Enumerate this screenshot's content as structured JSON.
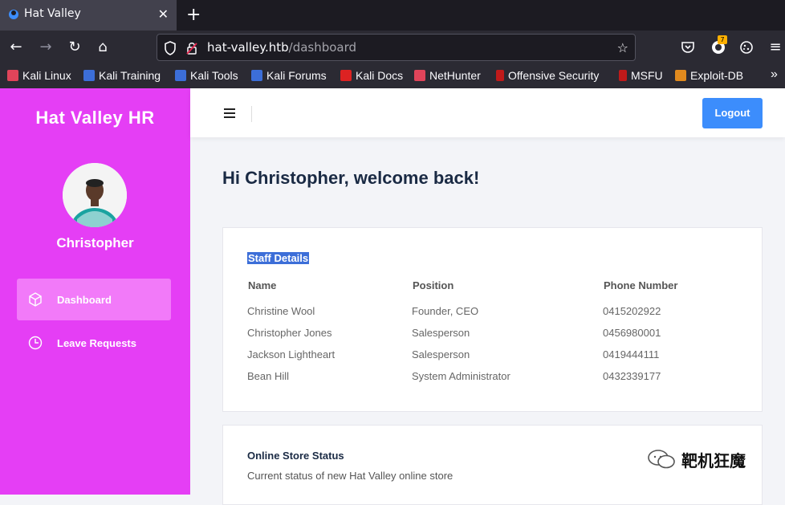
{
  "browser": {
    "tab_title": "Hat Valley",
    "url_host": "hat-valley.htb",
    "url_path": "/dashboard",
    "extension_badge": "7",
    "bookmarks": [
      "Kali Linux",
      "Kali Training",
      "Kali Tools",
      "Kali Forums",
      "Kali Docs",
      "NetHunter",
      "Offensive Security",
      "MSFU",
      "Exploit-DB"
    ]
  },
  "sidebar": {
    "brand": "Hat Valley HR",
    "user_name": "Christopher",
    "items": [
      {
        "label": "Dashboard",
        "icon": "cube-icon"
      },
      {
        "label": "Leave Requests",
        "icon": "clock-icon"
      }
    ]
  },
  "topbar": {
    "logout_label": "Logout"
  },
  "main": {
    "welcome": "Hi Christopher, welcome back!",
    "staff": {
      "title": "Staff Details",
      "columns": [
        "Name",
        "Position",
        "Phone Number"
      ],
      "rows": [
        [
          "Christine Wool",
          "Founder, CEO",
          "0415202922"
        ],
        [
          "Christopher Jones",
          "Salesperson",
          "0456980001"
        ],
        [
          "Jackson Lightheart",
          "Salesperson",
          "0419444111"
        ],
        [
          "Bean Hill",
          "System Administrator",
          "0432339177"
        ]
      ]
    },
    "store": {
      "title": "Online Store Status",
      "subtitle": "Current status of new Hat Valley online store"
    }
  },
  "watermark": "靶机狂魔",
  "colors": {
    "sidebar": "#e53ef5",
    "accent": "#3c8dfc"
  }
}
